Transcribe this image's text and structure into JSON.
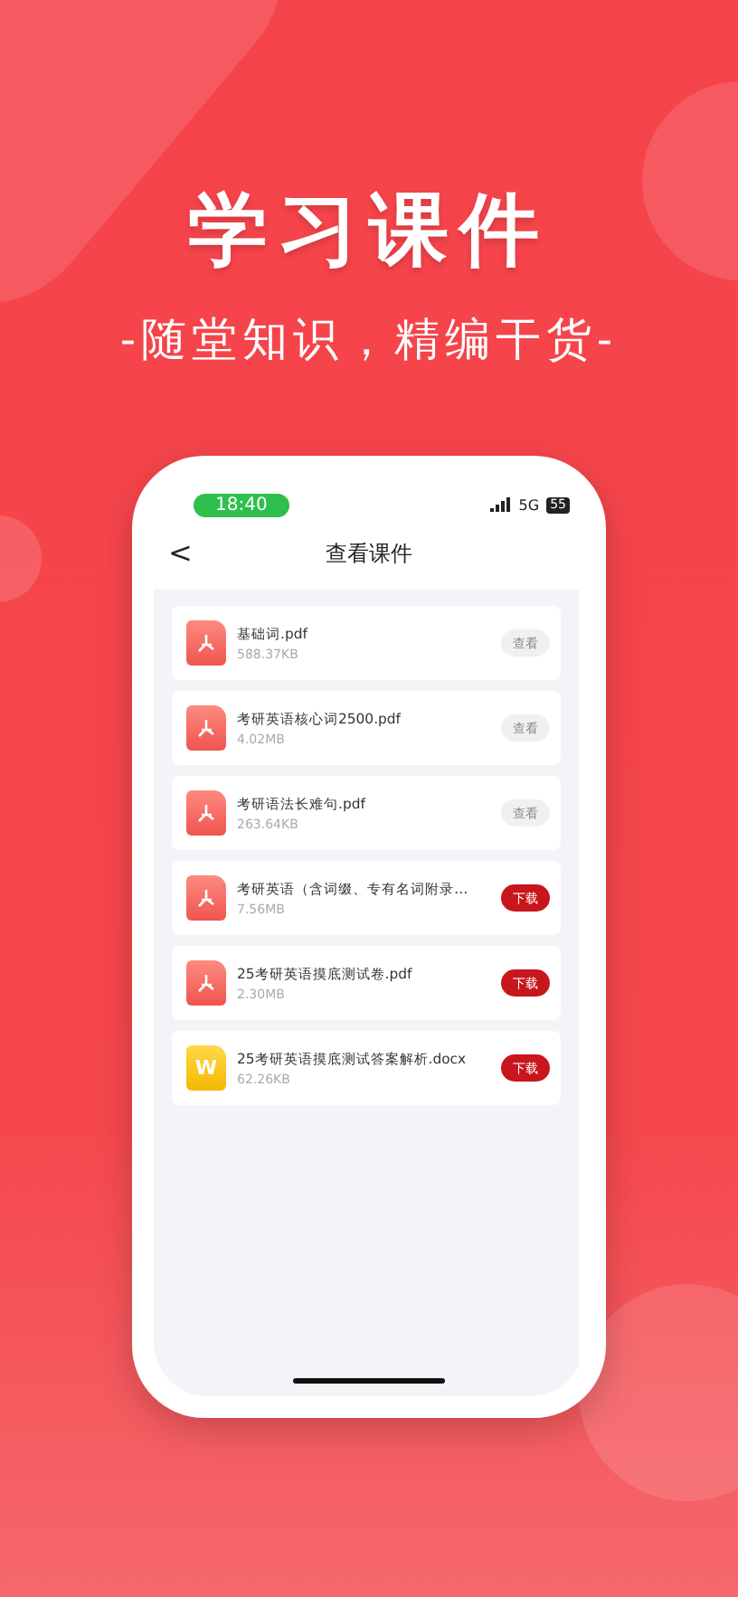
{
  "headline": "学习课件",
  "tagline": "-随堂知识，精编干货-",
  "status_bar": {
    "time": "18:40",
    "network": "5G",
    "battery": "55"
  },
  "nav": {
    "back": "<",
    "title": "查看课件"
  },
  "files": [
    {
      "kind": "pdf",
      "name": "基础词.pdf",
      "size": "588.37KB",
      "action": {
        "kind": "view",
        "label": "查看"
      }
    },
    {
      "kind": "pdf",
      "name": "考研英语核心词2500.pdf",
      "size": "4.02MB",
      "action": {
        "kind": "view",
        "label": "查看"
      }
    },
    {
      "kind": "pdf",
      "name": "考研语法长难句.pdf",
      "size": "263.64KB",
      "action": {
        "kind": "view",
        "label": "查看"
      }
    },
    {
      "kind": "pdf",
      "name": "考研英语（含词缀、专有名词附录…",
      "size": "7.56MB",
      "action": {
        "kind": "download",
        "label": "下载"
      }
    },
    {
      "kind": "pdf",
      "name": "25考研英语摸底测试卷.pdf",
      "size": "2.30MB",
      "action": {
        "kind": "download",
        "label": "下载"
      }
    },
    {
      "kind": "docx",
      "icon_text": "W",
      "name": "25考研英语摸底测试答案解析.docx",
      "size": "62.26KB",
      "action": {
        "kind": "download",
        "label": "下载"
      }
    }
  ]
}
